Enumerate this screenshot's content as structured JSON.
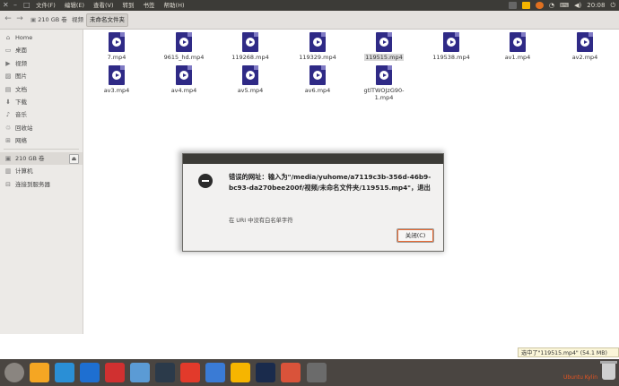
{
  "window": {
    "menus": [
      "文件(F)",
      "编辑(E)",
      "查看(V)",
      "转到",
      "书签",
      "帮助(H)"
    ]
  },
  "tray": {
    "time": "20:08",
    "icons": [
      "input-method-icon",
      "video-player-icon",
      "weather-icon",
      "wifi-icon",
      "keyboard-icon",
      "volume-icon",
      "clock",
      "power-icon"
    ]
  },
  "toolbar": {
    "breadcrumbs": [
      "210 GB 卷",
      "视频",
      "未命名文件夹"
    ]
  },
  "sidebar": {
    "places": [
      {
        "label": "Home",
        "icon": "home-icon"
      },
      {
        "label": "桌面",
        "icon": "desktop-icon"
      },
      {
        "label": "视频",
        "icon": "video-icon"
      },
      {
        "label": "图片",
        "icon": "picture-icon"
      },
      {
        "label": "文档",
        "icon": "document-icon"
      },
      {
        "label": "下载",
        "icon": "download-icon"
      },
      {
        "label": "音乐",
        "icon": "music-icon"
      },
      {
        "label": "回收站",
        "icon": "trash-icon"
      },
      {
        "label": "网络",
        "icon": "network-icon"
      }
    ],
    "devices": [
      {
        "label": "210 GB 卷",
        "icon": "drive-icon"
      },
      {
        "label": "计算机",
        "icon": "computer-icon"
      },
      {
        "label": "连接到服务器",
        "icon": "server-icon"
      }
    ]
  },
  "files": [
    {
      "name": "7.mp4",
      "selected": false
    },
    {
      "name": "9615_hd.mp4",
      "selected": false
    },
    {
      "name": "119268.mp4",
      "selected": false
    },
    {
      "name": "119329.mp4",
      "selected": false
    },
    {
      "name": "119515.mp4",
      "selected": true
    },
    {
      "name": "119538.mp4",
      "selected": false
    },
    {
      "name": "av1.mp4",
      "selected": false
    },
    {
      "name": "av2.mp4",
      "selected": false
    },
    {
      "name": "av3.mp4",
      "selected": false
    },
    {
      "name": "av4.mp4",
      "selected": false
    },
    {
      "name": "av5.mp4",
      "selected": false
    },
    {
      "name": "av6.mp4",
      "selected": false
    },
    {
      "name": "gtlTWOJzG90-1.mp4",
      "selected": false
    }
  ],
  "dialog": {
    "message": "错误的网址：输入为\"/media/yuhome/a7119c3b-356d-46b9-bc93-da270bee200f/视频/未命名文件夹/119515.mp4\"，退出",
    "detail": "在 URI 中没有白名单字符",
    "close_label": "关闭(C)"
  },
  "status": {
    "text": "选中了\"119515.mp4\" (54.1 MB)"
  },
  "dock": {
    "items": [
      "ubuntu-dash-icon",
      "files-icon",
      "chromium-icon",
      "wps-writer-icon",
      "uk-software-icon",
      "disk-icon",
      "terminal-icon",
      "netease-music-icon",
      "screenshot-icon",
      "video-player-icon",
      "qq-icon",
      "image-viewer-icon",
      "screen-icon"
    ],
    "colors": [
      "#8a8580",
      "#f5a623",
      "#2a8fd6",
      "#1e6fd1",
      "#d03030",
      "#5b9bd5",
      "#2b3a4a",
      "#e23a2b",
      "#3a7bd5",
      "#f6b500",
      "#1a2b4c",
      "#d9533a",
      "#6b6b6b"
    ],
    "ubuntu_label": "Ubuntu Kylin"
  },
  "colors": {
    "video_icon": "#2f2a86",
    "accent": "#e95420"
  }
}
